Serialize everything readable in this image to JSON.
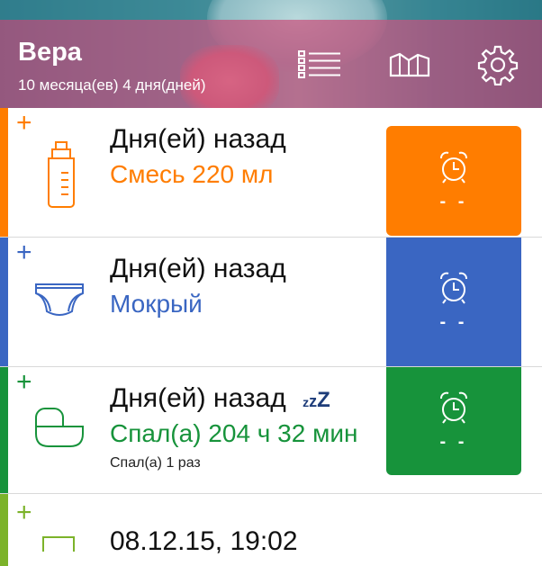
{
  "colors": {
    "header": "#cc3a6c",
    "feeding": "#ff7d00",
    "diaper": "#3a66c2",
    "sleep": "#17933b",
    "fourth": "#7cb32a"
  },
  "header": {
    "name": "Вера",
    "age": "10 месяца(ев) 4 дня(дней)",
    "icons": [
      "list-icon",
      "chart-icon",
      "gear-icon"
    ]
  },
  "rows": [
    {
      "plus": "+",
      "icon": "bottle-icon",
      "title": "Дня(ей) назад",
      "value": "Смесь 220 мл",
      "timer_icon": "alarm-clock-icon",
      "timer_text": "- -"
    },
    {
      "plus": "+",
      "icon": "diaper-icon",
      "title": "Дня(ей) назад",
      "value": "Мокрый",
      "timer_icon": "alarm-clock-icon",
      "timer_text": "- -"
    },
    {
      "plus": "+",
      "icon": "crib-icon",
      "title": "Дня(ей) назад",
      "sleep_glyph": [
        "z",
        "z",
        "Z"
      ],
      "value": "Спал(а) 204 ч 32 мин",
      "sub": "Спал(а) 1 раз",
      "timer_icon": "alarm-clock-icon",
      "timer_text": "- -"
    },
    {
      "plus": "+",
      "icon": "calendar-icon",
      "title": "08.12.15, 19:02"
    }
  ]
}
